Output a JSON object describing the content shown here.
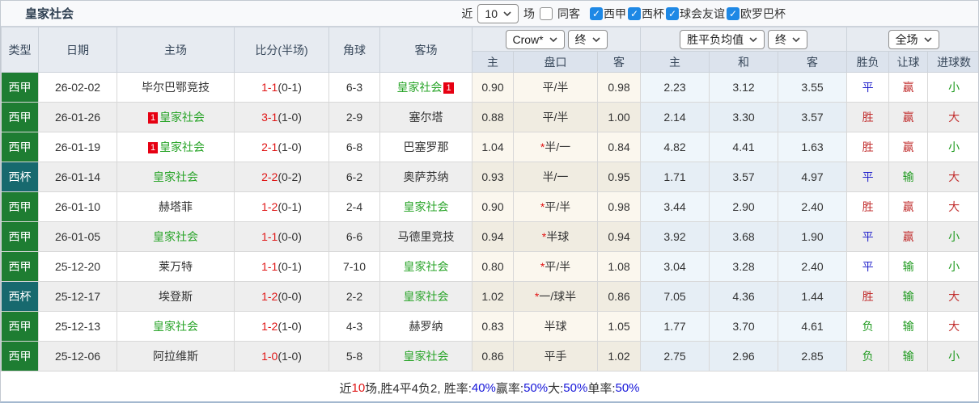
{
  "title": "皇家社会",
  "badge_text": "1",
  "topbar": {
    "recent_label": "近",
    "recent_value": "10",
    "games_label": "场",
    "same_venue": {
      "label": "同客",
      "checked": false
    },
    "filters": [
      {
        "label": "西甲",
        "checked": true
      },
      {
        "label": "西杯",
        "checked": true
      },
      {
        "label": "球会友谊",
        "checked": true
      },
      {
        "label": "欧罗巴杯",
        "checked": true
      }
    ]
  },
  "dropdowns": {
    "bookmaker": "Crow*",
    "final1": "终",
    "avg_type": "胜平负均值",
    "final2": "终",
    "scope": "全场"
  },
  "columns": {
    "main": [
      "类型",
      "日期",
      "主场",
      "比分(半场)",
      "角球",
      "客场"
    ],
    "sub": [
      "主",
      "盘口",
      "客",
      "主",
      "和",
      "客",
      "胜负",
      "让球",
      "进球数"
    ]
  },
  "colors": {
    "liga_bg": "#1e7d32",
    "cup_bg": "#17696e",
    "badge_bg": "#e60012",
    "self_team_green": "#28a428",
    "score_red": "#e01515",
    "win_red": "#c23030",
    "draw_blue": "#2525cc",
    "loss_green": "#1f9a1f",
    "footer_blue": "#1515d9"
  },
  "rows": [
    {
      "type": "西甲",
      "type_style": "liga",
      "date": "26-02-02",
      "home": {
        "name": "毕尔巴鄂竞技",
        "self": false,
        "badge": null
      },
      "score": "1-1",
      "half": "(0-1)",
      "corner": "6-3",
      "away": {
        "name": "皇家社会",
        "self": true,
        "badge": "after"
      },
      "o_home": "0.90",
      "pan": "平/半",
      "pan_star": false,
      "o_away": "0.98",
      "m_home": "2.23",
      "m_draw": "3.12",
      "m_away": "3.55",
      "res": {
        "t": "平",
        "c": "blue"
      },
      "letball": {
        "t": "赢",
        "c": "red"
      },
      "goal": {
        "t": "小",
        "c": "green"
      }
    },
    {
      "type": "西甲",
      "type_style": "liga",
      "date": "26-01-26",
      "home": {
        "name": "皇家社会",
        "self": true,
        "badge": "before"
      },
      "score": "3-1",
      "half": "(1-0)",
      "corner": "2-9",
      "away": {
        "name": "塞尔塔",
        "self": false,
        "badge": null
      },
      "o_home": "0.88",
      "pan": "平/半",
      "pan_star": false,
      "o_away": "1.00",
      "m_home": "2.14",
      "m_draw": "3.30",
      "m_away": "3.57",
      "res": {
        "t": "胜",
        "c": "red"
      },
      "letball": {
        "t": "赢",
        "c": "red"
      },
      "goal": {
        "t": "大",
        "c": "red"
      }
    },
    {
      "type": "西甲",
      "type_style": "liga",
      "date": "26-01-19",
      "home": {
        "name": "皇家社会",
        "self": true,
        "badge": "before"
      },
      "score": "2-1",
      "half": "(1-0)",
      "corner": "6-8",
      "away": {
        "name": "巴塞罗那",
        "self": false,
        "badge": null
      },
      "o_home": "1.04",
      "pan": "半/一",
      "pan_star": true,
      "o_away": "0.84",
      "m_home": "4.82",
      "m_draw": "4.41",
      "m_away": "1.63",
      "res": {
        "t": "胜",
        "c": "red"
      },
      "letball": {
        "t": "赢",
        "c": "red"
      },
      "goal": {
        "t": "小",
        "c": "green"
      }
    },
    {
      "type": "西杯",
      "type_style": "cup",
      "date": "26-01-14",
      "home": {
        "name": "皇家社会",
        "self": true,
        "badge": null
      },
      "score": "2-2",
      "half": "(0-2)",
      "corner": "6-2",
      "away": {
        "name": "奥萨苏纳",
        "self": false,
        "badge": null
      },
      "o_home": "0.93",
      "pan": "半/一",
      "pan_star": false,
      "o_away": "0.95",
      "m_home": "1.71",
      "m_draw": "3.57",
      "m_away": "4.97",
      "res": {
        "t": "平",
        "c": "blue"
      },
      "letball": {
        "t": "输",
        "c": "green"
      },
      "goal": {
        "t": "大",
        "c": "red"
      }
    },
    {
      "type": "西甲",
      "type_style": "liga",
      "date": "26-01-10",
      "home": {
        "name": "赫塔菲",
        "self": false,
        "badge": null
      },
      "score": "1-2",
      "half": "(0-1)",
      "corner": "2-4",
      "away": {
        "name": "皇家社会",
        "self": true,
        "badge": null
      },
      "o_home": "0.90",
      "pan": "平/半",
      "pan_star": true,
      "o_away": "0.98",
      "m_home": "3.44",
      "m_draw": "2.90",
      "m_away": "2.40",
      "res": {
        "t": "胜",
        "c": "red"
      },
      "letball": {
        "t": "赢",
        "c": "red"
      },
      "goal": {
        "t": "大",
        "c": "red"
      }
    },
    {
      "type": "西甲",
      "type_style": "liga",
      "date": "26-01-05",
      "home": {
        "name": "皇家社会",
        "self": true,
        "badge": null
      },
      "score": "1-1",
      "half": "(0-0)",
      "corner": "6-6",
      "away": {
        "name": "马德里竞技",
        "self": false,
        "badge": null
      },
      "o_home": "0.94",
      "pan": "半球",
      "pan_star": true,
      "o_away": "0.94",
      "m_home": "3.92",
      "m_draw": "3.68",
      "m_away": "1.90",
      "res": {
        "t": "平",
        "c": "blue"
      },
      "letball": {
        "t": "赢",
        "c": "red"
      },
      "goal": {
        "t": "小",
        "c": "green"
      }
    },
    {
      "type": "西甲",
      "type_style": "liga",
      "date": "25-12-20",
      "home": {
        "name": "莱万特",
        "self": false,
        "badge": null
      },
      "score": "1-1",
      "half": "(0-1)",
      "corner": "7-10",
      "away": {
        "name": "皇家社会",
        "self": true,
        "badge": null
      },
      "o_home": "0.80",
      "pan": "平/半",
      "pan_star": true,
      "o_away": "1.08",
      "m_home": "3.04",
      "m_draw": "3.28",
      "m_away": "2.40",
      "res": {
        "t": "平",
        "c": "blue"
      },
      "letball": {
        "t": "输",
        "c": "green"
      },
      "goal": {
        "t": "小",
        "c": "green"
      }
    },
    {
      "type": "西杯",
      "type_style": "cup",
      "date": "25-12-17",
      "home": {
        "name": "埃登斯",
        "self": false,
        "badge": null
      },
      "score": "1-2",
      "half": "(0-0)",
      "corner": "2-2",
      "away": {
        "name": "皇家社会",
        "self": true,
        "badge": null
      },
      "o_home": "1.02",
      "pan": "一/球半",
      "pan_star": true,
      "o_away": "0.86",
      "m_home": "7.05",
      "m_draw": "4.36",
      "m_away": "1.44",
      "res": {
        "t": "胜",
        "c": "red"
      },
      "letball": {
        "t": "输",
        "c": "green"
      },
      "goal": {
        "t": "大",
        "c": "red"
      }
    },
    {
      "type": "西甲",
      "type_style": "liga",
      "date": "25-12-13",
      "home": {
        "name": "皇家社会",
        "self": true,
        "badge": null
      },
      "score": "1-2",
      "half": "(1-0)",
      "corner": "4-3",
      "away": {
        "name": "赫罗纳",
        "self": false,
        "badge": null
      },
      "o_home": "0.83",
      "pan": "半球",
      "pan_star": false,
      "o_away": "1.05",
      "m_home": "1.77",
      "m_draw": "3.70",
      "m_away": "4.61",
      "res": {
        "t": "负",
        "c": "green"
      },
      "letball": {
        "t": "输",
        "c": "green"
      },
      "goal": {
        "t": "大",
        "c": "red"
      }
    },
    {
      "type": "西甲",
      "type_style": "liga",
      "date": "25-12-06",
      "home": {
        "name": "阿拉维斯",
        "self": false,
        "badge": null
      },
      "score": "1-0",
      "half": "(1-0)",
      "corner": "5-8",
      "away": {
        "name": "皇家社会",
        "self": true,
        "badge": null
      },
      "o_home": "0.86",
      "pan": "平手",
      "pan_star": false,
      "o_away": "1.02",
      "m_home": "2.75",
      "m_draw": "2.96",
      "m_away": "2.85",
      "res": {
        "t": "负",
        "c": "green"
      },
      "letball": {
        "t": "输",
        "c": "green"
      },
      "goal": {
        "t": "小",
        "c": "green"
      }
    }
  ],
  "footer": {
    "segments": [
      {
        "t": "近",
        "c": "dark"
      },
      {
        "t": "10",
        "c": "red"
      },
      {
        "t": "场,胜4平4负2, 胜率:",
        "c": "dark"
      },
      {
        "t": "40%",
        "c": "blue"
      },
      {
        "t": " 赢率:",
        "c": "dark"
      },
      {
        "t": "50%",
        "c": "blue"
      },
      {
        "t": " 大:",
        "c": "dark"
      },
      {
        "t": "50%",
        "c": "blue"
      },
      {
        "t": " 单率:",
        "c": "dark"
      },
      {
        "t": "50%",
        "c": "blue"
      }
    ]
  }
}
